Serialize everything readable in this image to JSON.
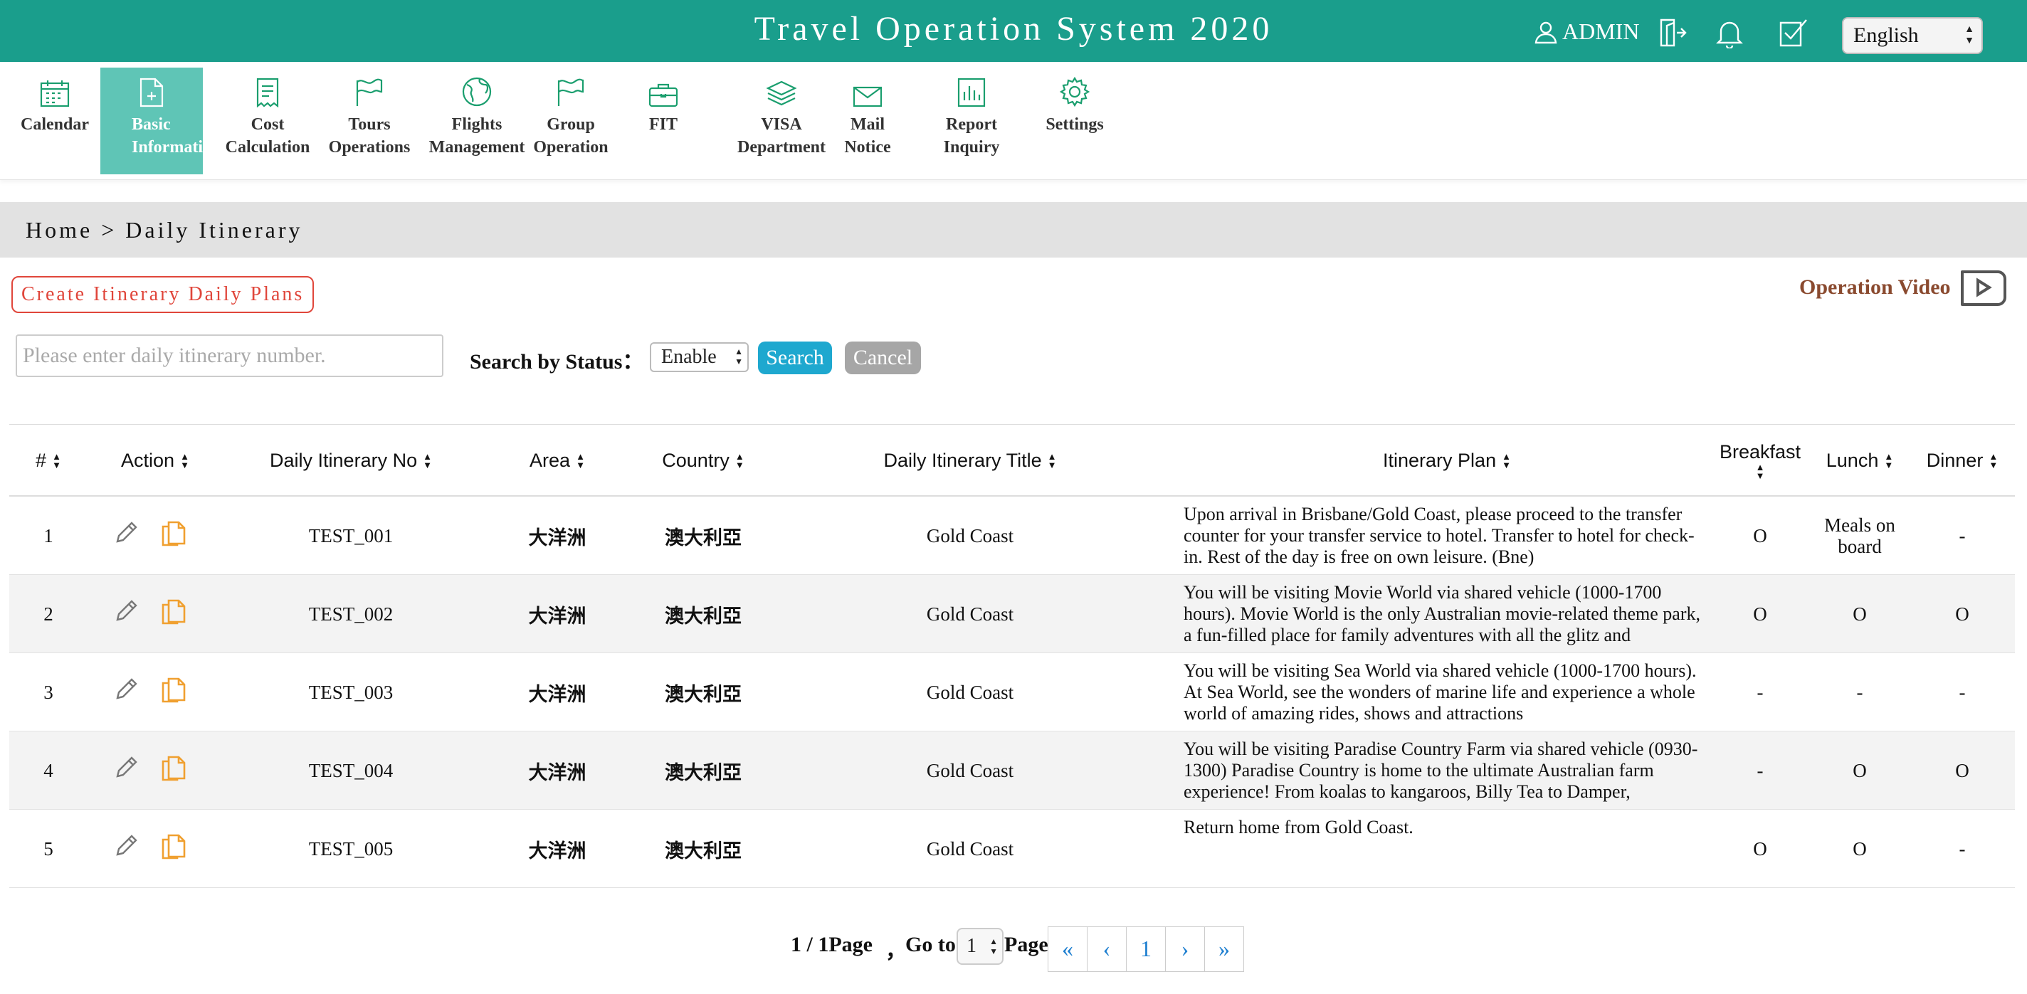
{
  "header": {
    "title": "Travel Operation System 2020",
    "user": "ADMIN",
    "language": "English"
  },
  "nav": [
    {
      "label": "Calendar",
      "icon": "calendar-icon"
    },
    {
      "label": "Basic\nInformation",
      "icon": "document-plus-icon",
      "active": true
    },
    {
      "label": "Cost\nCalculation",
      "icon": "receipt-icon"
    },
    {
      "label": "Tours\nOperations",
      "icon": "flag-icon"
    },
    {
      "label": "Flights\nManagement",
      "icon": "globe-icon"
    },
    {
      "label": "Group\nOperation",
      "icon": "flag-icon"
    },
    {
      "label": "FIT",
      "icon": "briefcase-icon"
    },
    {
      "label": "VISA\nDepartment",
      "icon": "layers-icon"
    },
    {
      "label": "Mail\nNotice",
      "icon": "mail-icon"
    },
    {
      "label": "Report\nInquiry",
      "icon": "bar-chart-icon"
    },
    {
      "label": "Settings",
      "icon": "gear-icon"
    }
  ],
  "breadcrumb": "Home > Daily Itinerary",
  "create_button": "Create Itinerary Daily Plans",
  "operation_video": "Operation Video",
  "search": {
    "placeholder": "Please enter daily itinerary number.",
    "status_label": "Search by Status：",
    "status_value": "Enable",
    "search_button": "Search",
    "cancel_button": "Cancel"
  },
  "table": {
    "columns": [
      "#",
      "Action",
      "Daily Itinerary No",
      "Area",
      "Country",
      "Daily Itinerary Title",
      "Itinerary Plan",
      "Breakfast",
      "Lunch",
      "Dinner"
    ],
    "rows": [
      {
        "num": "1",
        "no": "TEST_001",
        "area": "大洋洲",
        "country": "澳大利亞",
        "title": "Gold Coast",
        "plan": "Upon arrival in Brisbane/Gold Coast, please proceed to the transfer counter for your transfer service to hotel. Transfer to hotel for check-in. Rest of the day is free on own leisure. (Bne)",
        "breakfast": "O",
        "lunch": "Meals on board",
        "dinner": "-"
      },
      {
        "num": "2",
        "no": "TEST_002",
        "area": "大洋洲",
        "country": "澳大利亞",
        "title": "Gold Coast",
        "plan": "You will be visiting Movie World via shared vehicle (1000-1700 hours). Movie World is the only Australian movie-related theme park, a fun-filled place for family adventures with all the glitz and",
        "breakfast": "O",
        "lunch": "O",
        "dinner": "O"
      },
      {
        "num": "3",
        "no": "TEST_003",
        "area": "大洋洲",
        "country": "澳大利亞",
        "title": "Gold Coast",
        "plan": "You will be visiting Sea World via shared vehicle (1000-1700 hours). At Sea World, see the wonders of marine life and experience a whole world of amazing rides, shows and attractions",
        "breakfast": "-",
        "lunch": "-",
        "dinner": "-"
      },
      {
        "num": "4",
        "no": "TEST_004",
        "area": "大洋洲",
        "country": "澳大利亞",
        "title": "Gold Coast",
        "plan": "You will be visiting Paradise Country Farm via shared vehicle (0930-1300) Paradise Country is home to the ultimate Australian farm experience! From koalas to kangaroos, Billy Tea to Damper,",
        "breakfast": "-",
        "lunch": "O",
        "dinner": "O"
      },
      {
        "num": "5",
        "no": "TEST_005",
        "area": "大洋洲",
        "country": "澳大利亞",
        "title": "Gold Coast",
        "plan": "Return home from Gold Coast.",
        "breakfast": "O",
        "lunch": "O",
        "dinner": "-"
      }
    ]
  },
  "pagination": {
    "summary": "1 / 1Page",
    "separator": "，",
    "goto": "Go to",
    "page_value": "1",
    "page_word": "Page",
    "first": "«",
    "prev": "‹",
    "current": "1",
    "next": "›",
    "last": "»"
  },
  "colors": {
    "header_bg": "#1a9e8c",
    "nav_active_bg": "#5fc5b6",
    "icon_green": "#1a9e6e",
    "create_red": "#e0463b",
    "search_blue": "#1ea8cf",
    "cancel_gray": "#a6a6a6",
    "video_brown": "#8a4a2f",
    "copy_orange": "#f0a030"
  }
}
